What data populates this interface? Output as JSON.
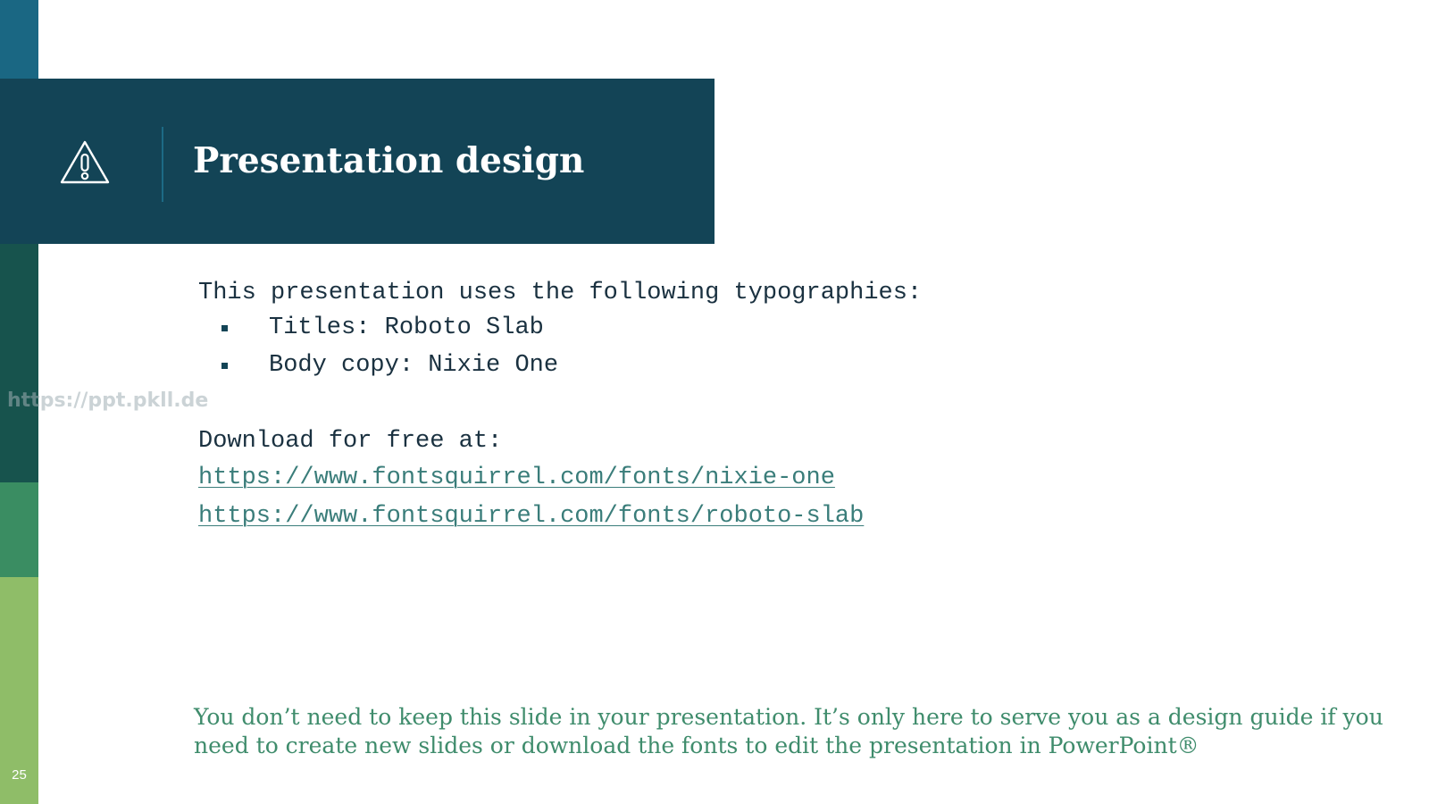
{
  "slide": {
    "title": "Presentation design",
    "page_number": "25",
    "icon": "warning-icon"
  },
  "body": {
    "intro": "This presentation uses the following typographies:",
    "bullets": [
      "Titles: Roboto Slab",
      "Body copy: Nixie One"
    ],
    "download_label": "Download for free at:",
    "links": [
      "https://www.fontsquirrel.com/fonts/nixie-one",
      "https://www.fontsquirrel.com/fonts/roboto-slab"
    ]
  },
  "watermark": "https://ppt.pkll.de",
  "note": "You don’t need to keep this slide in your presentation. It’s only here to serve you as a design guide if you need to create new slides or download the fonts to edit the presentation in PowerPoint®",
  "colors": {
    "banner": "#134456",
    "strip": [
      "#1a6783",
      "#17534d",
      "#3a8d62",
      "#8fbd68"
    ],
    "accent_text": "#3f8c6c",
    "link": "#3a7d7a"
  }
}
